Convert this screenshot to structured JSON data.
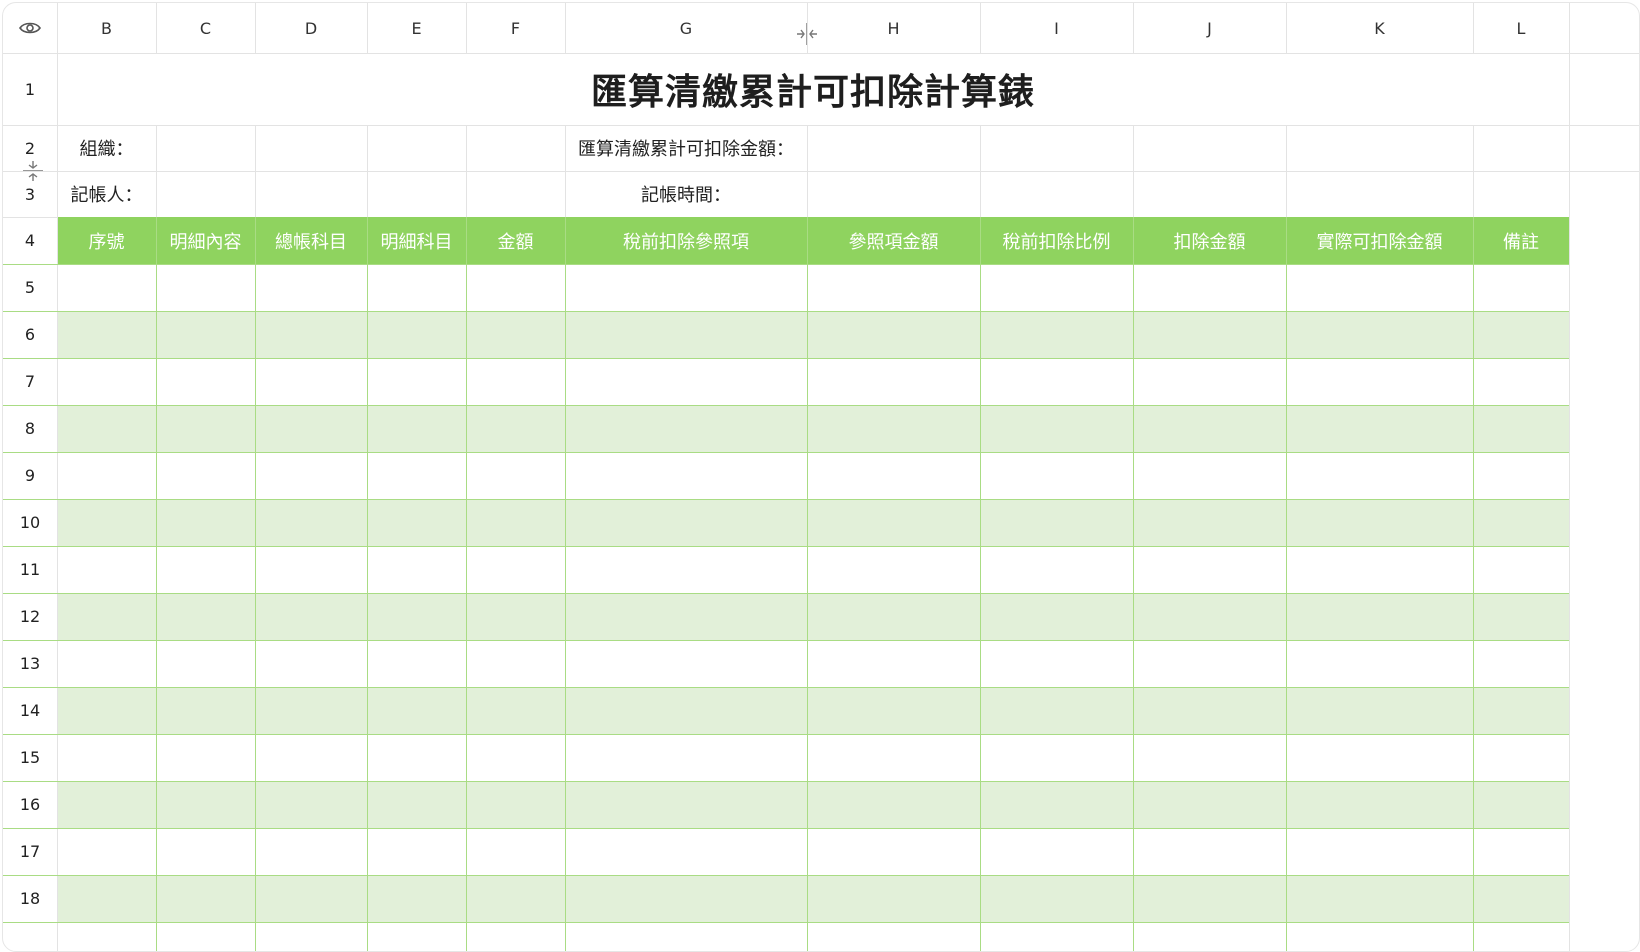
{
  "columns": [
    "B",
    "C",
    "D",
    "E",
    "F",
    "G",
    "H",
    "I",
    "J",
    "K",
    "L"
  ],
  "rows": [
    "1",
    "2",
    "3",
    "4",
    "5",
    "6",
    "7",
    "8",
    "9",
    "10",
    "11",
    "12",
    "13",
    "14",
    "15",
    "16",
    "17",
    "18"
  ],
  "title": "匯算清繳累計可扣除計算錶",
  "labels": {
    "org": "組織：",
    "bookkeeper": "記帳人：",
    "total_deductible": "匯算清繳累計可扣除金額：",
    "booking_time": "記帳時間："
  },
  "table_headers": [
    "序號",
    "明細內容",
    "總帳科目",
    "明細科目",
    "金額",
    "稅前扣除參照項",
    "參照項金額",
    "稅前扣除比例",
    "扣除金額",
    "實際可扣除金額",
    "備註"
  ],
  "colors": {
    "header_green": "#8fd35f",
    "band_green": "#e2f0d9",
    "table_line": "#a9dc84"
  },
  "icons": {
    "corner": "eye-icon",
    "column_resize": "column-resize-icon",
    "row_resize": "row-resize-icon"
  }
}
